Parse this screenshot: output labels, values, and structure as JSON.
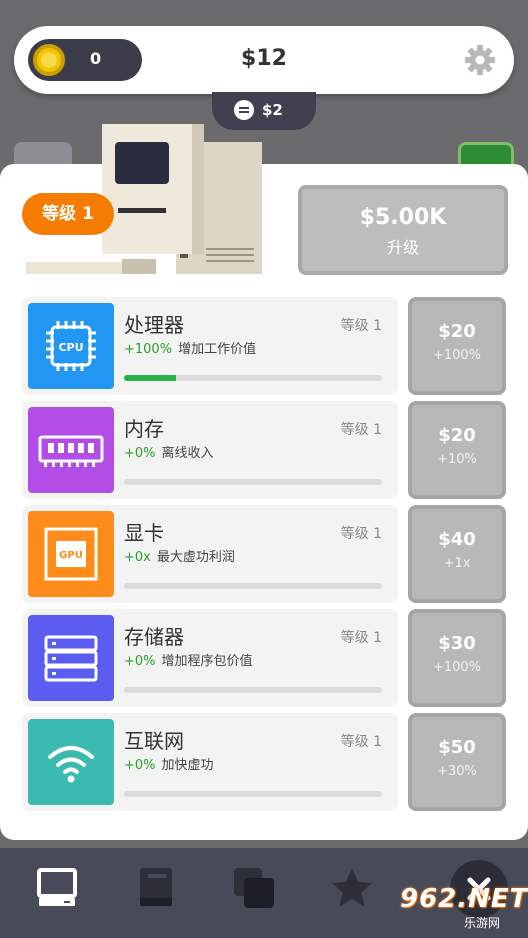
{
  "header": {
    "coins": "0",
    "balance": "$12",
    "income": "$2"
  },
  "machine": {
    "level_label": "等级 1",
    "upgrade_price": "$5.00K",
    "upgrade_label": "升级"
  },
  "components": [
    {
      "title": "处理器",
      "level": "等级 1",
      "pct": "+100%",
      "desc": "增加工作价值",
      "progress": 0.2,
      "price": "$20",
      "bonus": "+100%",
      "icon": "cpu-icon",
      "icon_text": "CPU",
      "color": "#2196f3"
    },
    {
      "title": "内存",
      "level": "等级 1",
      "pct": "+0%",
      "desc": "离线收入",
      "progress": 0,
      "price": "$20",
      "bonus": "+10%",
      "icon": "ram-icon",
      "icon_text": "",
      "color": "#b34de8"
    },
    {
      "title": "显卡",
      "level": "等级 1",
      "pct": "+0x",
      "desc": "最大虚功利润",
      "progress": 0,
      "price": "$40",
      "bonus": "+1x",
      "icon": "gpu-icon",
      "icon_text": "GPU",
      "color": "#ff8c1a"
    },
    {
      "title": "存储器",
      "level": "等级 1",
      "pct": "+0%",
      "desc": "增加程序包价值",
      "progress": 0,
      "price": "$30",
      "bonus": "+100%",
      "icon": "storage-icon",
      "icon_text": "",
      "color": "#5b5cf0"
    },
    {
      "title": "互联网",
      "level": "等级 1",
      "pct": "+0%",
      "desc": "加快虚功",
      "progress": 0,
      "price": "$50",
      "bonus": "+30%",
      "icon": "wifi-icon",
      "icon_text": "",
      "color": "#3bbbb0"
    }
  ],
  "nav": [
    "computer-icon",
    "book-icon",
    "layers-icon",
    "star-icon",
    "close-icon"
  ],
  "watermark": {
    "main": "962.NET",
    "sub": "乐游网"
  }
}
